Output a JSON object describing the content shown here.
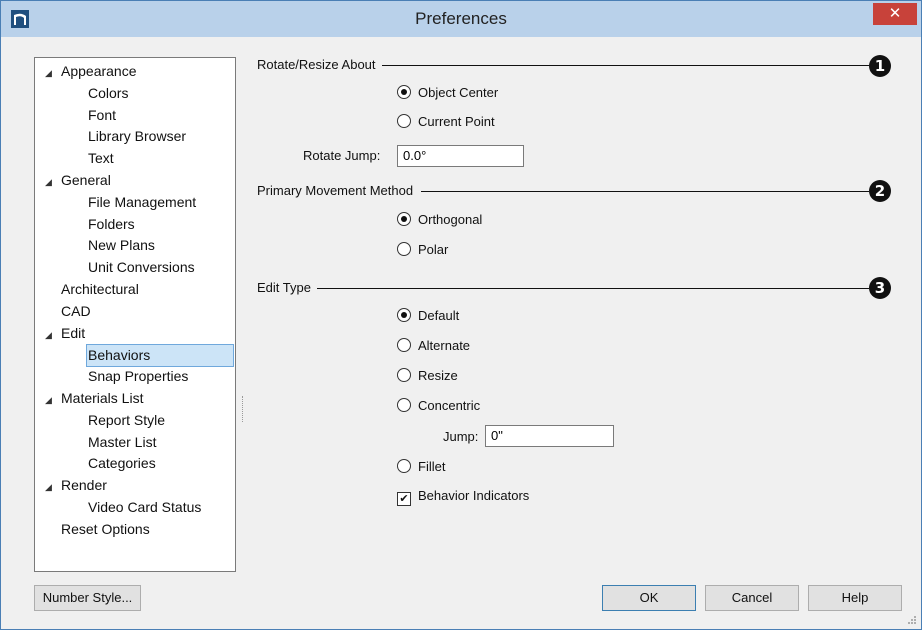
{
  "window": {
    "title": "Preferences"
  },
  "tree": [
    {
      "label": "Appearance",
      "level": 0,
      "expanded": true
    },
    {
      "label": "Colors",
      "level": 1
    },
    {
      "label": "Font",
      "level": 1
    },
    {
      "label": "Library Browser",
      "level": 1
    },
    {
      "label": "Text",
      "level": 1
    },
    {
      "label": "General",
      "level": 0,
      "expanded": true
    },
    {
      "label": "File Management",
      "level": 1
    },
    {
      "label": "Folders",
      "level": 1
    },
    {
      "label": "New Plans",
      "level": 1
    },
    {
      "label": "Unit Conversions",
      "level": 1
    },
    {
      "label": "Architectural",
      "level": 0
    },
    {
      "label": "CAD",
      "level": 0
    },
    {
      "label": "Edit",
      "level": 0,
      "expanded": true
    },
    {
      "label": "Behaviors",
      "level": 1,
      "selected": true
    },
    {
      "label": "Snap Properties",
      "level": 1
    },
    {
      "label": "Materials List",
      "level": 0,
      "expanded": true
    },
    {
      "label": "Report Style",
      "level": 1
    },
    {
      "label": "Master List",
      "level": 1
    },
    {
      "label": "Categories",
      "level": 1
    },
    {
      "label": "Render",
      "level": 0,
      "expanded": true
    },
    {
      "label": "Video Card Status",
      "level": 1
    },
    {
      "label": "Reset Options",
      "level": 0
    }
  ],
  "rotate": {
    "heading": "Rotate/Resize About",
    "callout": "1",
    "options": [
      {
        "label": "Object Center",
        "selected": true
      },
      {
        "label": "Current Point",
        "selected": false
      }
    ],
    "jump_label": "Rotate Jump:",
    "jump_value": "0.0°"
  },
  "movement": {
    "heading": "Primary Movement Method",
    "callout": "2",
    "options": [
      {
        "label": "Orthogonal",
        "selected": true
      },
      {
        "label": "Polar",
        "selected": false
      }
    ]
  },
  "edit": {
    "heading": "Edit Type",
    "callout": "3",
    "options": [
      {
        "label": "Default",
        "selected": true
      },
      {
        "label": "Alternate",
        "selected": false
      },
      {
        "label": "Resize",
        "selected": false
      },
      {
        "label": "Concentric",
        "selected": false
      }
    ],
    "jump_label": "Jump:",
    "jump_value": "0\"",
    "fillet_label": "Fillet",
    "fillet_selected": false,
    "indicators_label": "Behavior Indicators",
    "indicators_checked": true
  },
  "buttons": {
    "number_style": "Number Style...",
    "ok": "OK",
    "cancel": "Cancel",
    "help": "Help"
  },
  "colors": {
    "titlebar": "#b9d1ea",
    "close": "#c8423a",
    "selection": "#cce4f7"
  }
}
